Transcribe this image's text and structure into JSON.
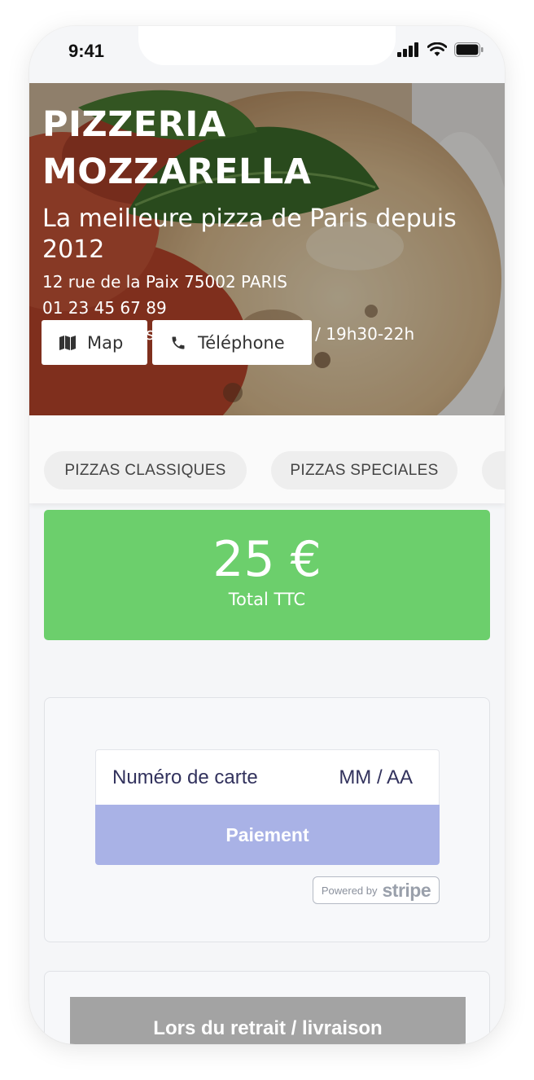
{
  "status_bar": {
    "time": "9:41"
  },
  "restaurant": {
    "name": "PIZZERIA MOZZARELLA",
    "tagline": "La meilleure pizza de Paris depuis 2012",
    "address": "12 rue de la Paix 75002 PARIS",
    "phone": "01 23 45 67 89",
    "hours": "du mardi au samedi - 12h-14h30 / 19h30-22h"
  },
  "hero_buttons": {
    "map_label": "Map",
    "phone_label": "Téléphone"
  },
  "categories": [
    "PIZZAS CLASSIQUES",
    "PIZZAS SPECIALES"
  ],
  "total": {
    "amount": "25 €",
    "label": "Total TTC"
  },
  "payment": {
    "card_number_placeholder": "Numéro de carte",
    "expiry_placeholder": "MM / AA",
    "pay_label": "Paiement",
    "powered_by": "Powered by",
    "stripe": "stripe"
  },
  "pickup": {
    "label": "Lors du retrait / livraison"
  },
  "colors": {
    "total_green": "#6ccf6c",
    "pay_button": "#a9b2e6",
    "pickup_button": "#a3a3a3",
    "card_text": "#32325d"
  }
}
